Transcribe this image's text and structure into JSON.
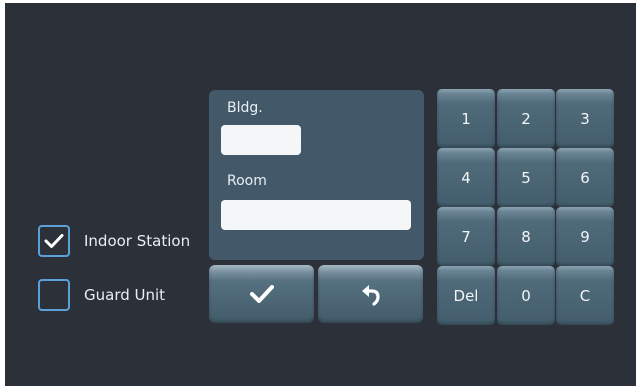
{
  "options": {
    "indoor_station": {
      "label": "Indoor Station",
      "checked": true
    },
    "guard_unit": {
      "label": "Guard Unit",
      "checked": false
    }
  },
  "form": {
    "bldg_label": "Bldg.",
    "bldg_value": "",
    "room_label": "Room",
    "room_value": ""
  },
  "actions": {
    "confirm_icon": "checkmark-icon",
    "back_icon": "return-arrow-icon"
  },
  "keypad": {
    "keys": [
      "1",
      "2",
      "3",
      "4",
      "5",
      "6",
      "7",
      "8",
      "9",
      "Del",
      "0",
      "C"
    ]
  },
  "colors": {
    "background": "#2b3039",
    "panel": "#43596a",
    "checkbox_border": "#5ca0d8",
    "text": "#e9eef2"
  }
}
